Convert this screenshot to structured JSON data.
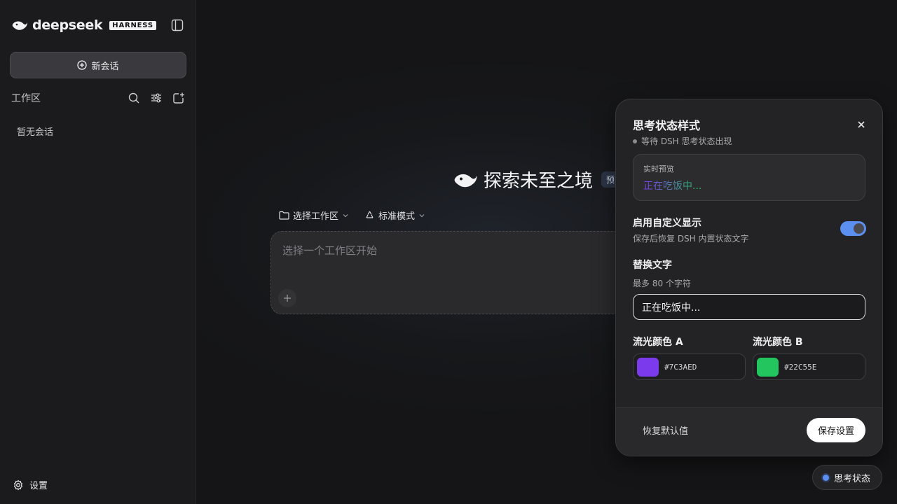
{
  "sidebar": {
    "brand": "deepseek",
    "brand_badge": "HARNESS",
    "new_chat_label": "新会话",
    "workspace_label": "工作区",
    "empty_text": "暂无会话",
    "settings_label": "设置",
    "icons": [
      "whale-logo-icon",
      "sidebar-toggle-icon",
      "plus-circle-icon",
      "search-icon",
      "sliders-icon",
      "new-folder-icon",
      "gear-icon"
    ]
  },
  "main": {
    "hero_title": "探索未至之境",
    "hero_badge": "预览",
    "workspace_select": "选择工作区",
    "mode_select": "标准模式",
    "composer_placeholder": "选择一个工作区开始"
  },
  "panel": {
    "title": "思考状态样式",
    "status": "等待 DSH 思考状态出现",
    "preview_label": "实时预览",
    "preview_text": "正在吃饭中...",
    "toggle_title": "启用自定义显示",
    "toggle_desc": "保存后恢复 DSH 内置状态文字",
    "toggle_on": true,
    "replace_title": "替换文字",
    "replace_desc": "最多 80 个字符",
    "replace_value": "正在吃饭中...",
    "color_a_label": "流光颜色 A",
    "color_a": "#7C3AED",
    "color_b_label": "流光颜色 B",
    "color_b": "#22C55E",
    "reset_label": "恢复默认值",
    "save_label": "保存设置"
  },
  "status_pill": {
    "label": "思考状态",
    "accent": "#5B8FF0"
  }
}
